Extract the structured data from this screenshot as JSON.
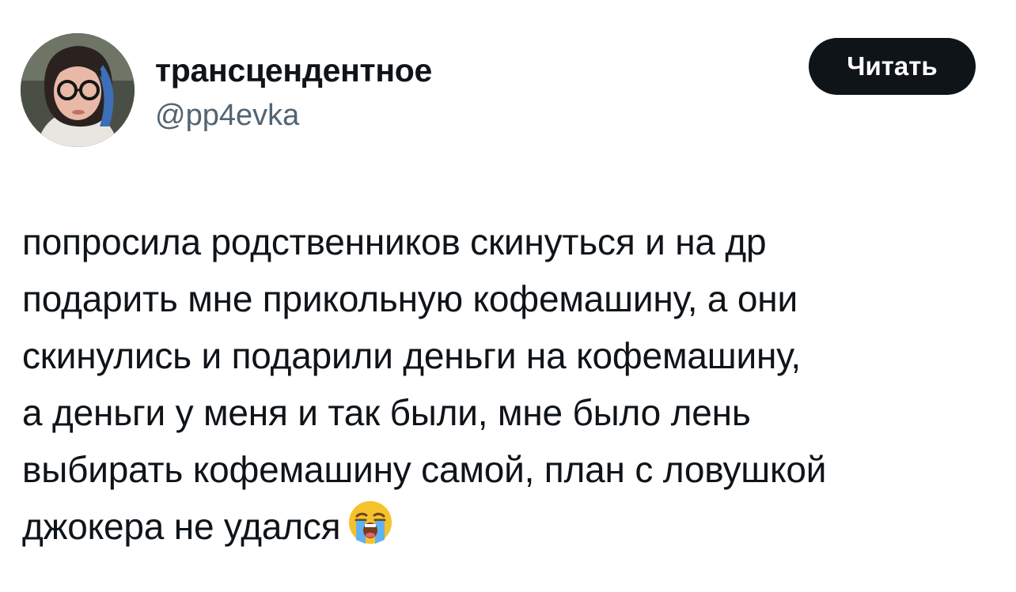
{
  "author": {
    "display_name": "трансцендентное",
    "handle": "@pp4evka"
  },
  "actions": {
    "read_label": "Читать"
  },
  "tweet": {
    "lines": [
      "попросила родственников скинуться и на др",
      "подарить мне прикольную кофемашину, а они",
      "скинулись и подарили деньги на кофемашину,",
      "а деньги у меня и так были, мне было лень",
      "выбирать кофемашину самой, план с ловушкой",
      "джокера не удался"
    ],
    "emoji": "loudly-crying-face-icon"
  },
  "colors": {
    "text": "#0f1419",
    "secondary": "#536471",
    "button_bg": "#0f1419",
    "button_text": "#ffffff"
  }
}
